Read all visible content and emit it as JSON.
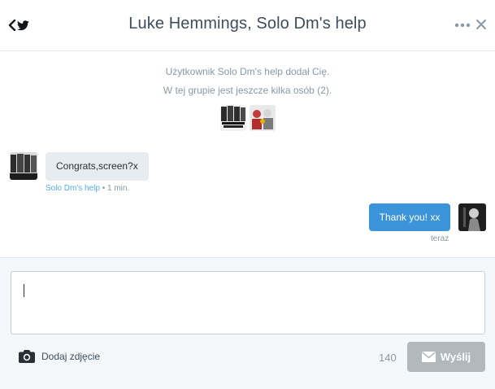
{
  "header": {
    "title": "Luke Hemmings, Solo Dm's help",
    "back_icon": "chevron-left-icon",
    "bird_icon": "twitter-bird-icon",
    "more_icon": "more-dots-icon",
    "close_icon": "close-icon"
  },
  "system_messages": {
    "added": "Użytkownik Solo Dm's help dodał Cię.",
    "group_info": "W tej grupie jest jeszcze kilka osób (2)."
  },
  "messages": [
    {
      "direction": "incoming",
      "text": "Congrats,screen?x",
      "sender": "Solo Dm's help",
      "separator": " • ",
      "time": "1 min."
    },
    {
      "direction": "outgoing",
      "text": "Thank you! xx",
      "time": "teraz"
    }
  ],
  "composer": {
    "value": "",
    "add_photo_label": "Dodaj zdjęcie",
    "camera_icon": "camera-icon",
    "char_count": "140",
    "send_label": "Wyślij",
    "send_icon": "envelope-icon",
    "send_enabled": false
  },
  "colors": {
    "accent": "#55acee",
    "outgoing_bubble": "#3b94d9",
    "incoming_bubble": "#e6ecf0",
    "send_disabled": "#b2b8bc",
    "meta_text": "#8899a6",
    "composer_bg": "#f5f8fa"
  }
}
